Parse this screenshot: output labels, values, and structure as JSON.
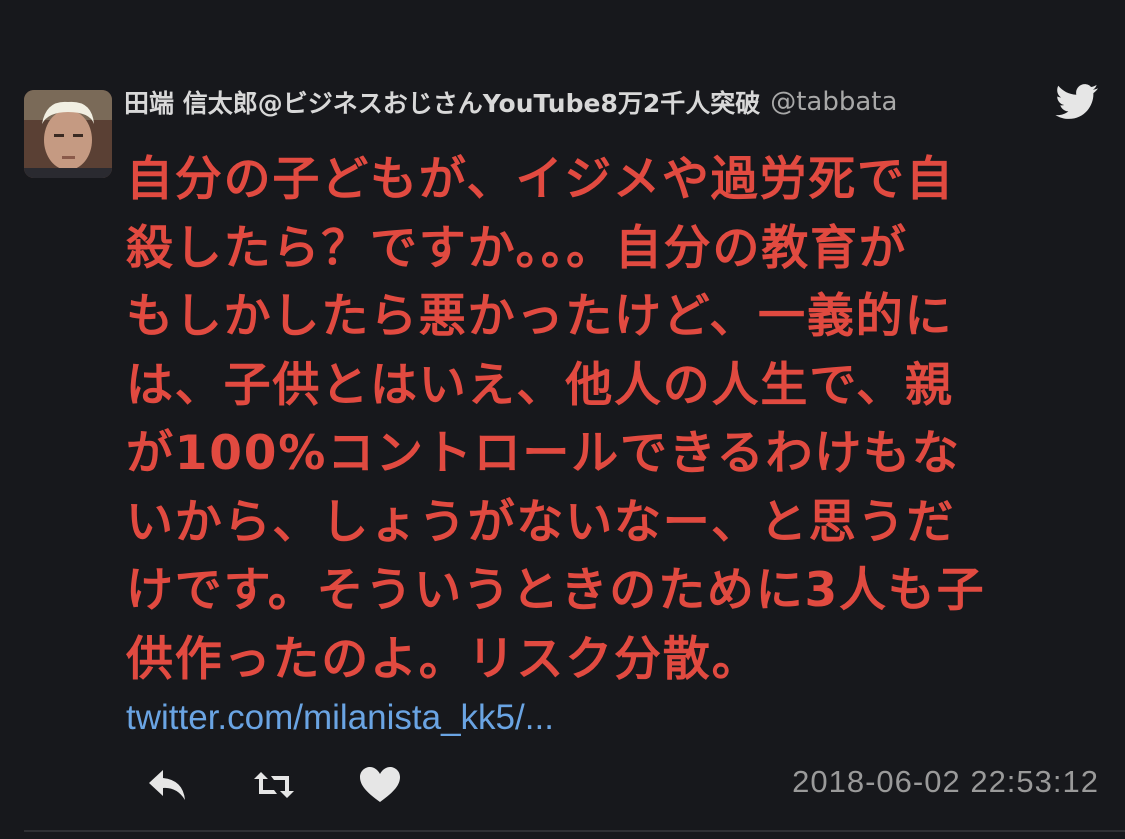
{
  "tweet": {
    "author": {
      "display_name": "田端 信太郎@ビジネスおじさんYouTube8万2千人突破",
      "handle": "@tabbata",
      "avatar_icon": "avatar-photo"
    },
    "body_lines": [
      "自分の子どもが、イジメや過労死で自",
      "殺したら？ですか。。。自分の教育が",
      "もしかしたら悪かったけど、一義的に",
      "は、子供とはいえ、他人の人生で、親",
      "が100%コントロールできるわけもな",
      "いから、しょうがないなー、と思うだ",
      "けです。そういうときのために3人も子",
      "供作ったのよ。リスク分散。"
    ],
    "link": "twitter.com/milanista_kk5/...",
    "timestamp": "2018-06-02 22:53:12"
  },
  "icons": {
    "brand": "twitter-bird-icon",
    "reply": "reply-icon",
    "retweet": "retweet-icon",
    "like": "heart-icon"
  },
  "colors": {
    "background": "#17181c",
    "body_text": "#e14a40",
    "link": "#6aa4e3",
    "name": "#d8d8d8",
    "muted": "#9a9a9a"
  }
}
